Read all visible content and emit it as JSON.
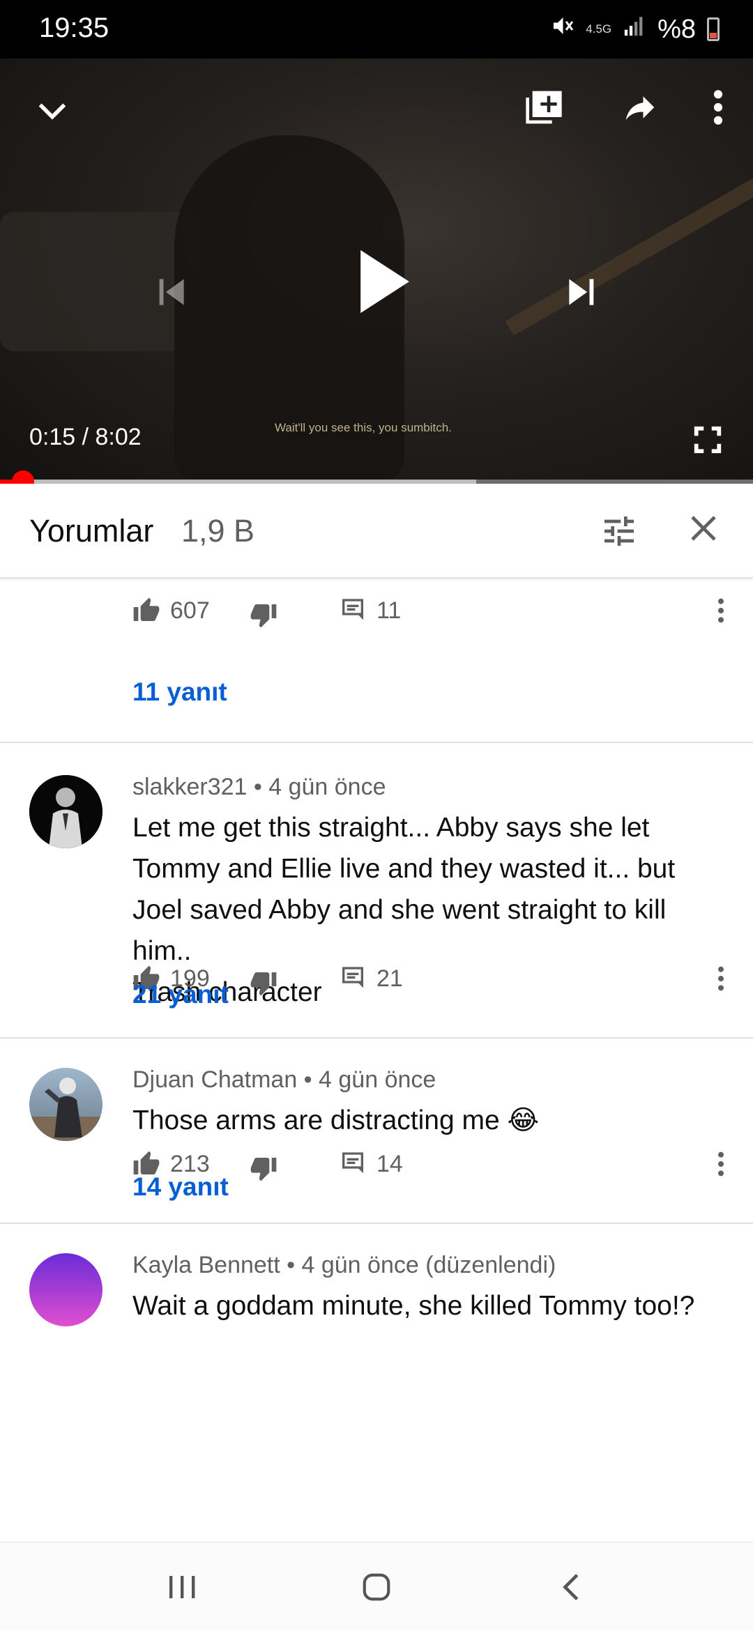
{
  "status_bar": {
    "time": "19:35",
    "network": "4.5G",
    "battery": "%8",
    "icons": [
      "mute-vibrate-icon",
      "signal-icon",
      "battery-low-icon"
    ]
  },
  "player": {
    "current_time": "0:15",
    "separator": "/",
    "duration": "8:02",
    "time_display": "0:15 / 8:02",
    "subtitle": "Wait'll you see this, you sumbitch.",
    "played_fraction": 0.031,
    "buffered_fraction": 0.632,
    "accent_color": "#ff0000"
  },
  "comments_header": {
    "title": "Yorumlar",
    "count": "1,9 B"
  },
  "comments": [
    {
      "author": "",
      "meta": "",
      "body": "",
      "likes": "607",
      "replies_count": "11",
      "replies_link": "11 yanıt"
    },
    {
      "author": "slakker321",
      "meta": "slakker321 • 4 gün önce",
      "body": "Let me get this straight... Abby says she let Tommy and Ellie live and they wasted it... but Joel saved Abby and she went straight to kill him..\nTrash character",
      "likes": "199",
      "replies_count": "21",
      "replies_link": "21 yanıt"
    },
    {
      "author": "Djuan Chatman",
      "meta": "Djuan Chatman • 4 gün önce",
      "body": "Those arms are distracting me 😂",
      "likes": "213",
      "replies_count": "14",
      "replies_link": "14 yanıt"
    },
    {
      "author": "Kayla Bennett",
      "meta": "Kayla Bennett • 4 gün önce (düzenlendi)",
      "body": "Wait a goddam minute, she killed Tommy too!?"
    }
  ],
  "nav_bar": {
    "buttons": [
      "recent-apps-icon",
      "home-icon",
      "back-icon"
    ]
  }
}
